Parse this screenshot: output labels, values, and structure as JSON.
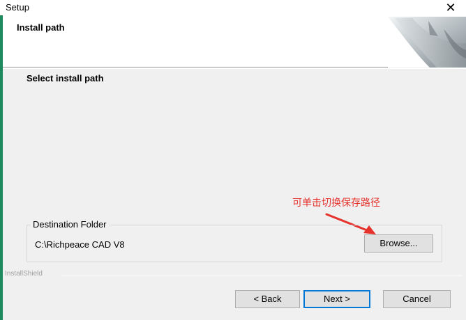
{
  "window": {
    "title": "Setup",
    "close_glyph": "✕"
  },
  "header": {
    "title": "Install path",
    "logo_icon": "installshield-curl-logo"
  },
  "main": {
    "subtitle": "Select install path",
    "annotation": "可单击切换保存路径",
    "annotation_color": "#e5322d"
  },
  "destination": {
    "group_label": "Destination Folder",
    "path": "C:\\Richpeace CAD V8",
    "browse_label": "Browse..."
  },
  "footer": {
    "brand": "InstallShield",
    "back_label": "< Back",
    "next_label": "Next >",
    "cancel_label": "Cancel"
  },
  "colors": {
    "accent": "#0078d7",
    "left_strip": "#1e8a5e"
  }
}
